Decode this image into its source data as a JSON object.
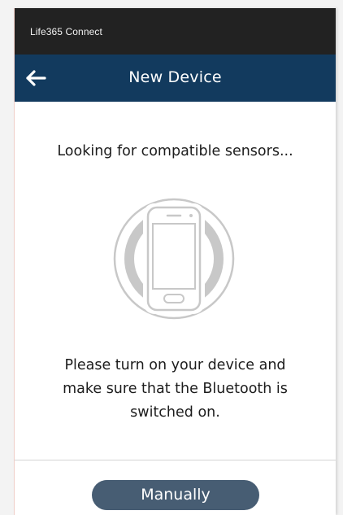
{
  "status_bar": {
    "app_name": "Life365 Connect"
  },
  "header": {
    "back_icon": "arrow-left-icon",
    "title": "New Device"
  },
  "main": {
    "searching_text": "Looking for compatible sensors...",
    "illustration_icon": "phone-wireless-icon",
    "instruction_lines": [
      "Please turn on your device and",
      "make sure that the Bluetooth is",
      "switched on."
    ]
  },
  "footer": {
    "manual_button_label": "Manually"
  },
  "colors": {
    "status_bar": "#222222",
    "app_bar": "#123a5e",
    "button": "#475d73",
    "illustration_stroke": "#c8c8c8"
  }
}
